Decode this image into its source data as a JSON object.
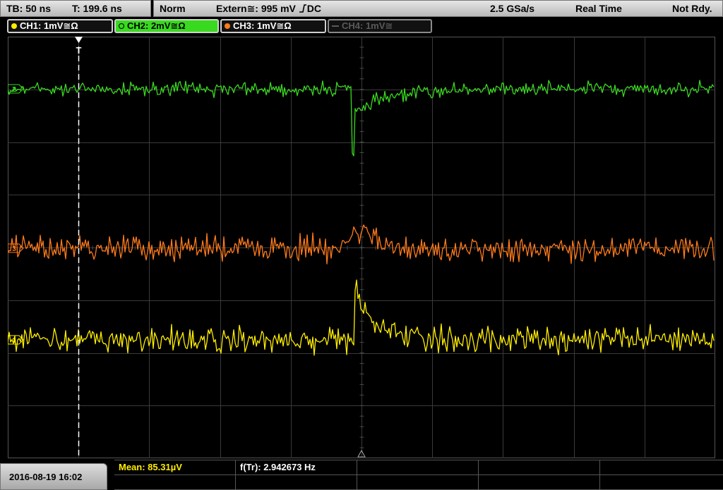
{
  "topbar": {
    "timebase": "TB: 50 ns",
    "trigger_time": "T: 199.6 ns",
    "trigger_mode": "Norm",
    "trigger_source": "Extern",
    "trigger_level": "≅: 995 mV",
    "trigger_slope_icon": "rising-edge-icon",
    "trigger_coupling": "DC",
    "sample_rate": "2.5 GSa/s",
    "acq_mode": "Real Time",
    "status": "Not Rdy."
  },
  "channels": [
    {
      "label": "CH1: 1mV≅Ω",
      "color": "#ffee00",
      "active": false,
      "enabled": true
    },
    {
      "label": "CH2: 2mV≅Ω",
      "color": "#39d91f",
      "active": true,
      "enabled": true
    },
    {
      "label": "CH3: 1mV≅Ω",
      "color": "#ff7a1a",
      "active": false,
      "enabled": true
    },
    {
      "label": "CH4: 1mV≅",
      "color": "#5a5a5a",
      "active": false,
      "enabled": false
    }
  ],
  "screen": {
    "trigger_marker": "T",
    "grid_color": "#3a3a3a",
    "ch_marker_labels": {
      "ch1": "1",
      "ch2": "2",
      "ch3": "3"
    }
  },
  "bottombar": {
    "datetime": "2016-08-19 16:02",
    "measurements": [
      {
        "label": "Mean: 85.31µV",
        "color": "#ffee00"
      },
      {
        "label": "f(Tr): 2.942673 Hz",
        "color": "#ffffff"
      }
    ]
  }
}
